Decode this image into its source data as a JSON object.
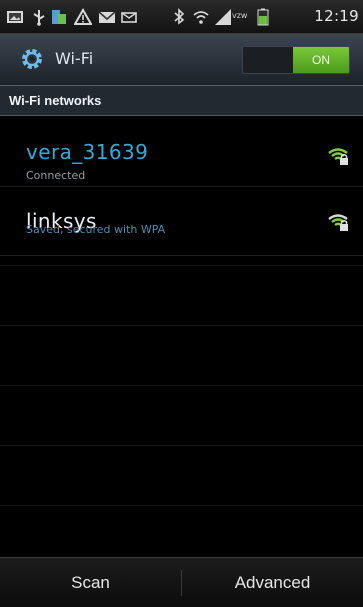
{
  "status_bar": {
    "time": "12:19",
    "network_label": "vzw",
    "icons": [
      "gallery-icon",
      "usb-icon",
      "usb-connection-icon",
      "warning-icon",
      "gmail-icon",
      "email-icon",
      "bluetooth-icon",
      "wifi-icon",
      "signal-icon",
      "battery-icon"
    ]
  },
  "header": {
    "title": "Wi-Fi",
    "toggle_label": "ON"
  },
  "section": {
    "title": "Wi-Fi networks"
  },
  "networks": [
    {
      "name": "vera_31639",
      "status": "Connected",
      "connected": true,
      "signal_icon": "wifi-signal-locked-icon"
    },
    {
      "name": "linksys",
      "status": "Saved, secured with WPA",
      "connected": false,
      "signal_icon": "wifi-signal-locked-icon"
    }
  ],
  "bottom_bar": {
    "scan_label": "Scan",
    "advanced_label": "Advanced"
  },
  "colors": {
    "connected_name": "#35a8d6",
    "toggle_on": "#5fb12a",
    "header_bg": "#2c343c"
  }
}
